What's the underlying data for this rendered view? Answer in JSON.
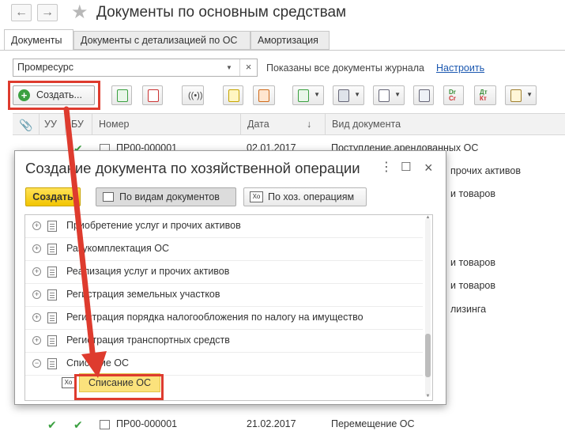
{
  "window": {
    "title": "Документы по основным средствам",
    "back_icon": "arrow-left-icon",
    "forward_icon": "arrow-right-icon",
    "favorite_icon": "star-icon"
  },
  "tabs": [
    {
      "label": "Документы",
      "active": true
    },
    {
      "label": "Документы с детализацией по ОС",
      "active": false
    },
    {
      "label": "Амортизация",
      "active": false
    }
  ],
  "filter": {
    "organization_value": "Промресурс",
    "status_text": "Показаны все документы журнала",
    "configure_link": "Настроить"
  },
  "toolbar": {
    "create_label": "Создать..."
  },
  "grid": {
    "columns": [
      "УУ",
      "БУ",
      "Номер",
      "Дата",
      "Вид документа"
    ],
    "rows": [
      {
        "number": "ПР00-000001",
        "date": "02.01.2017",
        "type": "Поступление арендованных ОС"
      },
      {
        "number": "",
        "date": "",
        "type": "прочих активов"
      },
      {
        "number": "",
        "date": "",
        "type": "и товаров"
      },
      {
        "number": "",
        "date": "",
        "type": "и товаров"
      },
      {
        "number": "",
        "date": "",
        "type": "и товаров"
      },
      {
        "number": "",
        "date": "",
        "type": "лизинга"
      },
      {
        "number": "ПР00-000001",
        "date": "21.02.2017",
        "type": "Перемещение ОС"
      }
    ]
  },
  "dialog": {
    "title": "Создание документа по хозяйственной операции",
    "create_button": "Создать",
    "by_doc_types_button": "По видам документов",
    "by_operations_button": "По хоз. операциям",
    "items": [
      "Приобретение услуг и прочих активов",
      "Разукомплектация ОС",
      "Реализация услуг и прочих активов",
      "Регистрация земельных участков",
      "Регистрация порядка налогообложения по налогу на имущество",
      "Регистрация транспортных средств",
      "Списание ОС"
    ],
    "sub_item_icon_text": "Xo",
    "selected_sub_item": "Списание ОС"
  },
  "colors": {
    "highlight_red": "#de3b2e",
    "create_yellow": "#f2c500",
    "selected_yellow": "#fbe27c",
    "check_green": "#3aa040",
    "link_blue": "#1a57b0"
  }
}
